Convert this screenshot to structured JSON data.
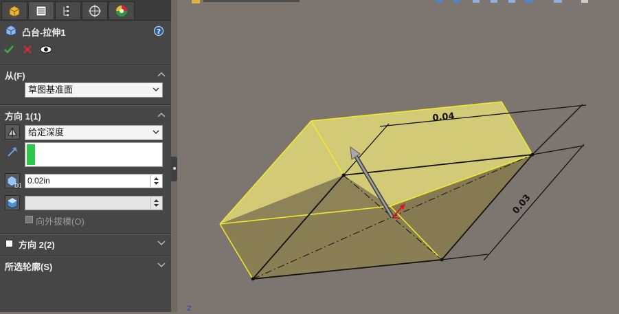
{
  "panel": {
    "feature_title": "凸台-拉伸1",
    "help_icon": "help-icon",
    "ok_icon": "checkmark-icon",
    "cancel_icon": "close-icon",
    "preview_icon": "eye-icon"
  },
  "tabs": [
    "feature-manager-icon",
    "property-manager-icon",
    "configuration-manager-icon",
    "dimxpert-icon",
    "display-manager-icon"
  ],
  "from": {
    "title": "从(F)",
    "value": "草图基准面"
  },
  "direction1": {
    "title": "方向 1(1)",
    "end_condition": "给定深度",
    "depth": "0.02in",
    "draft_outward_label": "向外拔模(O)"
  },
  "direction2": {
    "title": "方向 2(2)"
  },
  "contours": {
    "title": "所选轮廓(S)"
  },
  "viewport": {
    "dim_width": "0.04",
    "dim_depth": "0.03",
    "axis_label": "Z",
    "colors": {
      "box_top": "#d9d27a",
      "box_side": "#8e8258",
      "edge": "#f2ec2a",
      "background": "#7d7670"
    }
  }
}
